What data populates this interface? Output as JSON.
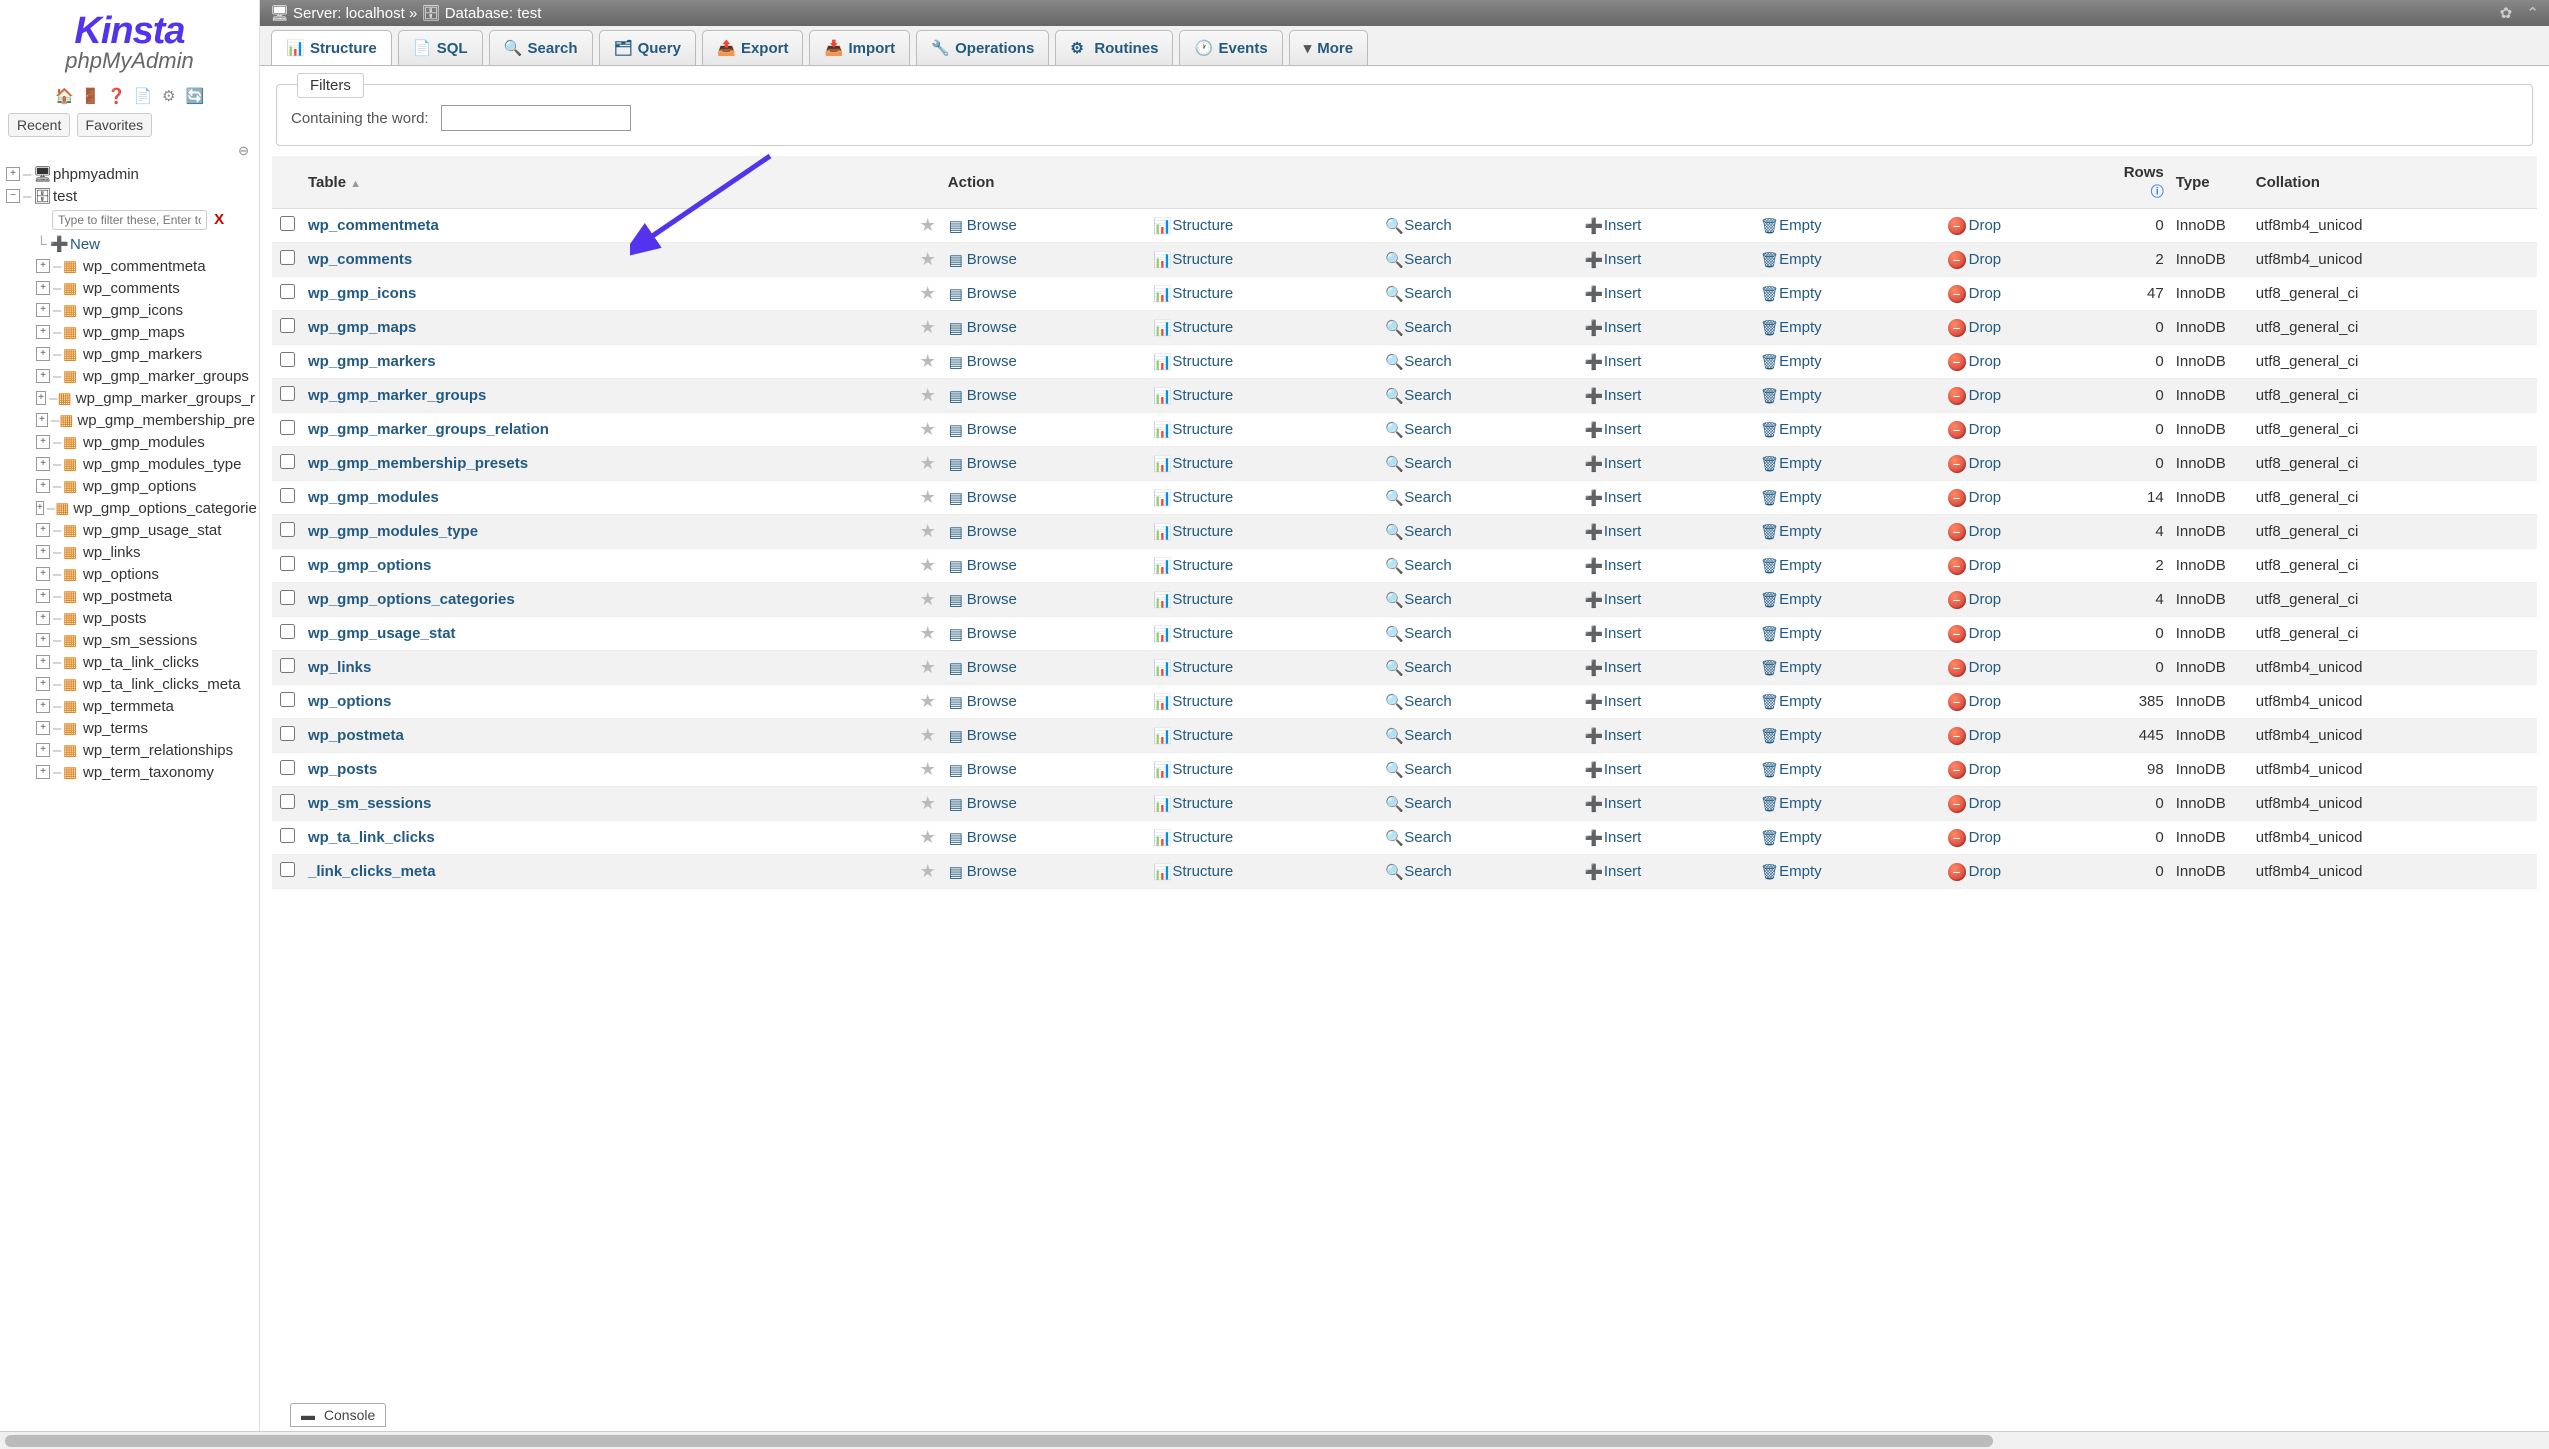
{
  "logo": {
    "brand": "Kinsta",
    "sub": "phpMyAdmin"
  },
  "recent_label": "Recent",
  "favorites_label": "Favorites",
  "breadcrumb": {
    "server_label": "Server:",
    "server_name": "localhost",
    "db_label": "Database:",
    "db_name": "test"
  },
  "tree": {
    "root": "phpmyadmin",
    "db": "test",
    "filter_placeholder": "Type to filter these, Enter to search",
    "new_label": "New",
    "tables": [
      "wp_commentmeta",
      "wp_comments",
      "wp_gmp_icons",
      "wp_gmp_maps",
      "wp_gmp_markers",
      "wp_gmp_marker_groups",
      "wp_gmp_marker_groups_r",
      "wp_gmp_membership_pre",
      "wp_gmp_modules",
      "wp_gmp_modules_type",
      "wp_gmp_options",
      "wp_gmp_options_categorie",
      "wp_gmp_usage_stat",
      "wp_links",
      "wp_options",
      "wp_postmeta",
      "wp_posts",
      "wp_sm_sessions",
      "wp_ta_link_clicks",
      "wp_ta_link_clicks_meta",
      "wp_termmeta",
      "wp_terms",
      "wp_term_relationships",
      "wp_term_taxonomy"
    ]
  },
  "tabs": [
    {
      "label": "Structure",
      "icon": "📊",
      "active": true
    },
    {
      "label": "SQL",
      "icon": "📄"
    },
    {
      "label": "Search",
      "icon": "🔍"
    },
    {
      "label": "Query",
      "icon": "🗂"
    },
    {
      "label": "Export",
      "icon": "📤"
    },
    {
      "label": "Import",
      "icon": "📥"
    },
    {
      "label": "Operations",
      "icon": "🔧"
    },
    {
      "label": "Routines",
      "icon": "⚙"
    },
    {
      "label": "Events",
      "icon": "🕐"
    },
    {
      "label": "More",
      "icon": "▾",
      "more": true
    }
  ],
  "filters": {
    "legend": "Filters",
    "label": "Containing the word:"
  },
  "table_headers": {
    "table": "Table",
    "action": "Action",
    "rows": "Rows",
    "type": "Type",
    "collation": "Collation"
  },
  "actions": {
    "browse": "Browse",
    "structure": "Structure",
    "search": "Search",
    "insert": "Insert",
    "empty": "Empty",
    "drop": "Drop"
  },
  "console_label": "Console",
  "rows": [
    {
      "name": "wp_commentmeta",
      "rows": "0",
      "type": "InnoDB",
      "collation": "utf8mb4_unicod"
    },
    {
      "name": "wp_comments",
      "rows": "2",
      "type": "InnoDB",
      "collation": "utf8mb4_unicod"
    },
    {
      "name": "wp_gmp_icons",
      "rows": "47",
      "type": "InnoDB",
      "collation": "utf8_general_ci"
    },
    {
      "name": "wp_gmp_maps",
      "rows": "0",
      "type": "InnoDB",
      "collation": "utf8_general_ci"
    },
    {
      "name": "wp_gmp_markers",
      "rows": "0",
      "type": "InnoDB",
      "collation": "utf8_general_ci"
    },
    {
      "name": "wp_gmp_marker_groups",
      "rows": "0",
      "type": "InnoDB",
      "collation": "utf8_general_ci"
    },
    {
      "name": "wp_gmp_marker_groups_relation",
      "rows": "0",
      "type": "InnoDB",
      "collation": "utf8_general_ci"
    },
    {
      "name": "wp_gmp_membership_presets",
      "rows": "0",
      "type": "InnoDB",
      "collation": "utf8_general_ci"
    },
    {
      "name": "wp_gmp_modules",
      "rows": "14",
      "type": "InnoDB",
      "collation": "utf8_general_ci"
    },
    {
      "name": "wp_gmp_modules_type",
      "rows": "4",
      "type": "InnoDB",
      "collation": "utf8_general_ci"
    },
    {
      "name": "wp_gmp_options",
      "rows": "2",
      "type": "InnoDB",
      "collation": "utf8_general_ci"
    },
    {
      "name": "wp_gmp_options_categories",
      "rows": "4",
      "type": "InnoDB",
      "collation": "utf8_general_ci"
    },
    {
      "name": "wp_gmp_usage_stat",
      "rows": "0",
      "type": "InnoDB",
      "collation": "utf8_general_ci"
    },
    {
      "name": "wp_links",
      "rows": "0",
      "type": "InnoDB",
      "collation": "utf8mb4_unicod"
    },
    {
      "name": "wp_options",
      "rows": "385",
      "type": "InnoDB",
      "collation": "utf8mb4_unicod"
    },
    {
      "name": "wp_postmeta",
      "rows": "445",
      "type": "InnoDB",
      "collation": "utf8mb4_unicod"
    },
    {
      "name": "wp_posts",
      "rows": "98",
      "type": "InnoDB",
      "collation": "utf8mb4_unicod"
    },
    {
      "name": "wp_sm_sessions",
      "rows": "0",
      "type": "InnoDB",
      "collation": "utf8mb4_unicod"
    },
    {
      "name": "wp_ta_link_clicks",
      "rows": "0",
      "type": "InnoDB",
      "collation": "utf8mb4_unicod"
    },
    {
      "name": "_link_clicks_meta",
      "rows": "0",
      "type": "InnoDB",
      "collation": "utf8mb4_unicod"
    }
  ]
}
